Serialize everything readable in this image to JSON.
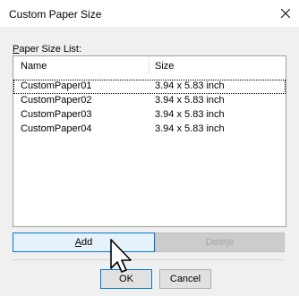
{
  "window": {
    "title": "Custom Paper Size",
    "close_icon": "close-icon"
  },
  "list": {
    "group_label_key": "P",
    "group_label_rest": "aper Size List:",
    "columns": [
      "Name",
      "Size"
    ],
    "rows": [
      {
        "name": "CustomPaper01",
        "size": "3.94 x 5.83 inch"
      },
      {
        "name": "CustomPaper02",
        "size": "3.94 x 5.83 inch"
      },
      {
        "name": "CustomPaper03",
        "size": "3.94 x 5.83 inch"
      },
      {
        "name": "CustomPaper04",
        "size": "3.94 x 5.83 inch"
      }
    ]
  },
  "buttons": {
    "add_key": "A",
    "add_rest": "dd",
    "delete_pre": "Dele",
    "delete_key": "t",
    "delete_post": "e",
    "ok": "OK",
    "cancel": "Cancel"
  },
  "colors": {
    "focus_border": "#0078d7",
    "hover_fill": "#e5f1fb"
  }
}
